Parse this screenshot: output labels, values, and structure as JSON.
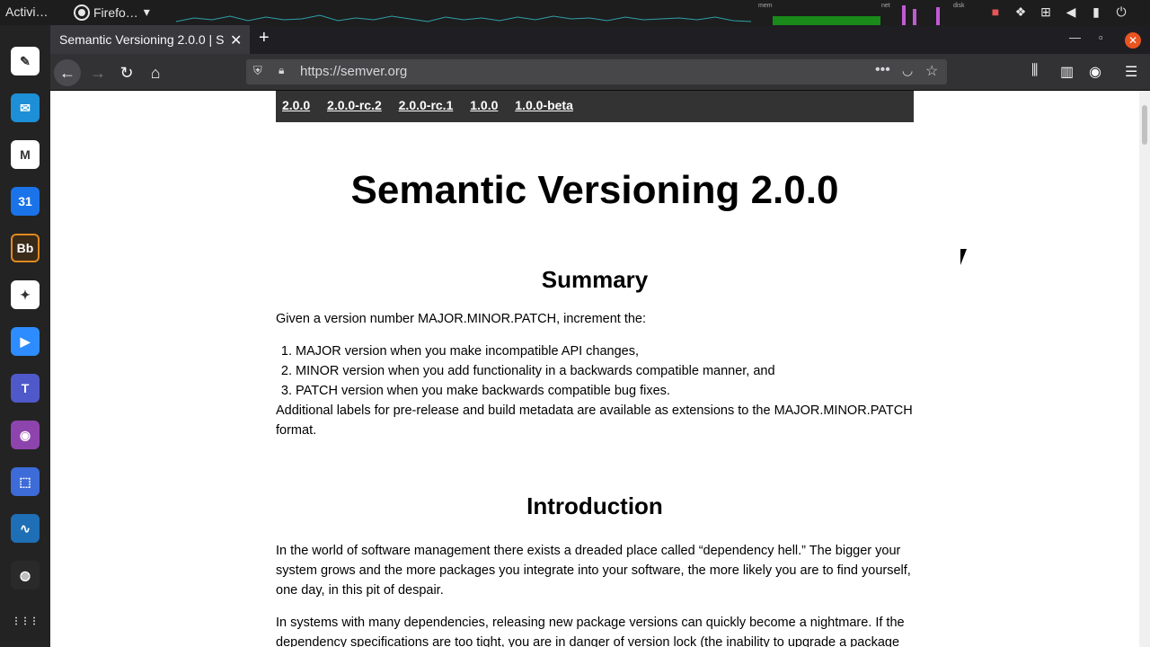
{
  "topbar": {
    "activities": "Activi…",
    "app_name": "Firefo…",
    "monitor_labels": [
      "mem",
      "net",
      "disk"
    ],
    "tray_icons": [
      "camera-icon",
      "dropbox-icon",
      "network-icon",
      "volume-icon",
      "microphone-icon",
      "power-icon"
    ]
  },
  "dock": {
    "apps": [
      {
        "name": "text-editor",
        "glyph": "✎",
        "color": "#ffffff"
      },
      {
        "name": "mail",
        "glyph": "✉",
        "color": "#1d8fd6"
      },
      {
        "name": "gmail",
        "glyph": "M",
        "color": "#ffffff"
      },
      {
        "name": "calendar",
        "glyph": "31",
        "color": "#1a73e8"
      },
      {
        "name": "blackboard",
        "glyph": "Bb",
        "color": "#3a2a1a"
      },
      {
        "name": "bird-app",
        "glyph": "✦",
        "color": "#ffffff"
      },
      {
        "name": "zoom",
        "glyph": "▶",
        "color": "#2d8cff"
      },
      {
        "name": "teams",
        "glyph": "T",
        "color": "#5059c9"
      },
      {
        "name": "video-app",
        "glyph": "◉",
        "color": "#8e44ad"
      },
      {
        "name": "screenshot",
        "glyph": "⬚",
        "color": "#3d6bd8"
      },
      {
        "name": "system-monitor",
        "glyph": "∿",
        "color": "#1e6fb5"
      },
      {
        "name": "security-app",
        "glyph": "◍",
        "color": "#2a2a2a"
      },
      {
        "name": "show-apps",
        "glyph": "⋮⋮⋮",
        "color": "#232323"
      }
    ]
  },
  "browser": {
    "tab_title": "Semantic Versioning 2.0.0 | S",
    "url": "https://semver.org"
  },
  "page": {
    "versions": [
      "2.0.0",
      "2.0.0-rc.2",
      "2.0.0-rc.1",
      "1.0.0",
      "1.0.0-beta"
    ],
    "title": "Semantic Versioning 2.0.0",
    "summary_heading": "Summary",
    "summary_intro": "Given a version number MAJOR.MINOR.PATCH, increment the:",
    "summary_list": [
      "MAJOR version when you make incompatible API changes,",
      "MINOR version when you add functionality in a backwards compatible manner, and",
      "PATCH version when you make backwards compatible bug fixes."
    ],
    "summary_after": "Additional labels for pre-release and build metadata are available as extensions to the MAJOR.MINOR.PATCH format.",
    "intro_heading": "Introduction",
    "intro_p1": "In the world of software management there exists a dreaded place called “dependency hell.” The bigger your system grows and the more packages you integrate into your software, the more likely you are to find yourself, one day, in this pit of despair.",
    "intro_p2": "In systems with many dependencies, releasing new package versions can quickly become a nightmare. If the dependency specifications are too tight, you are in danger of version lock (the inability to upgrade a package"
  }
}
